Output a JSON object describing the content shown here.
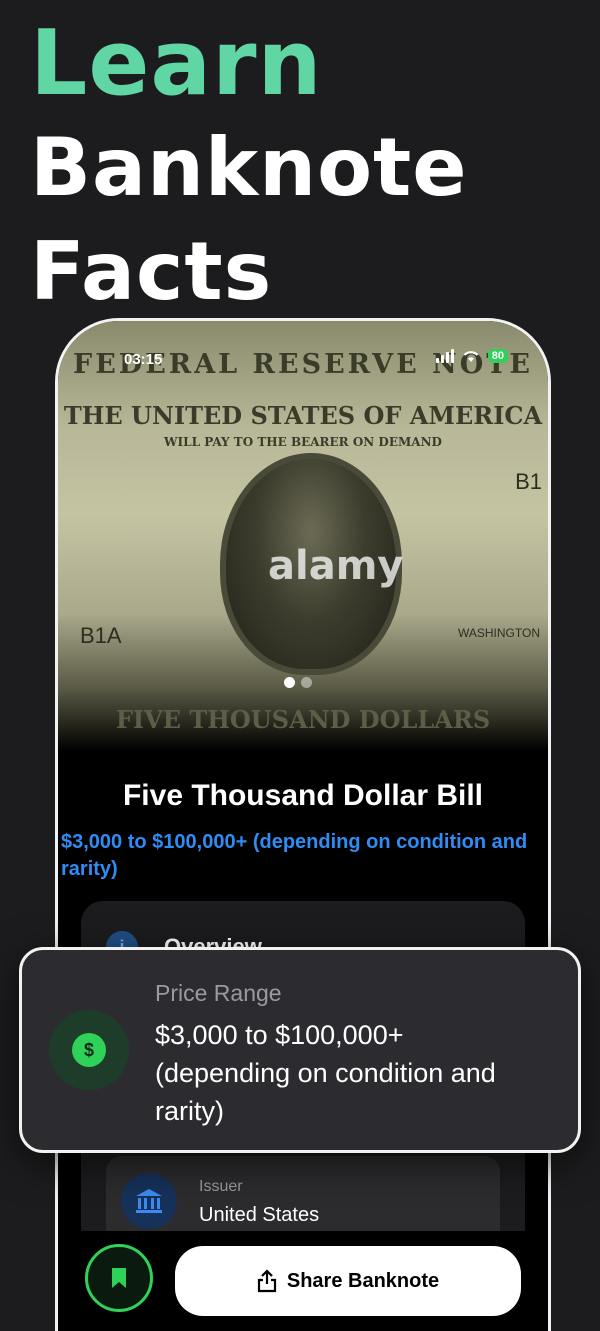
{
  "headline": {
    "line1": "Learn",
    "line2": "Banknote",
    "line3": "Facts",
    "accent_color": "#5fd6a4"
  },
  "status_bar": {
    "time": "03:15",
    "battery": "80"
  },
  "hero_image": {
    "note_header": "FEDERAL RESERVE NOTE",
    "note_country": "THE UNITED STATES OF AMERICA",
    "note_promise": "WILL PAY TO THE BEARER ON DEMAND",
    "serial_left": "B1A",
    "serial_right": "B1",
    "signer": "WASHINGTON",
    "denomination_text": "FIVE THOUSAND DOLLARS",
    "watermark": "alamy",
    "carousel_total": 2,
    "carousel_active": 0
  },
  "banknote": {
    "title": "Five Thousand Dollar Bill",
    "price_range": "$3,000 to $100,000+ (depending on condition and rarity)"
  },
  "overview": {
    "label": "Overview"
  },
  "issuer": {
    "label": "Issuer",
    "value": "United States"
  },
  "actions": {
    "share_label": "Share Banknote"
  },
  "popup": {
    "label": "Price Range",
    "value": "$3,000 to $100,000+ (depending on condition and rarity)"
  },
  "colors": {
    "accent_green": "#30d158",
    "link_blue": "#2f8cf5"
  }
}
